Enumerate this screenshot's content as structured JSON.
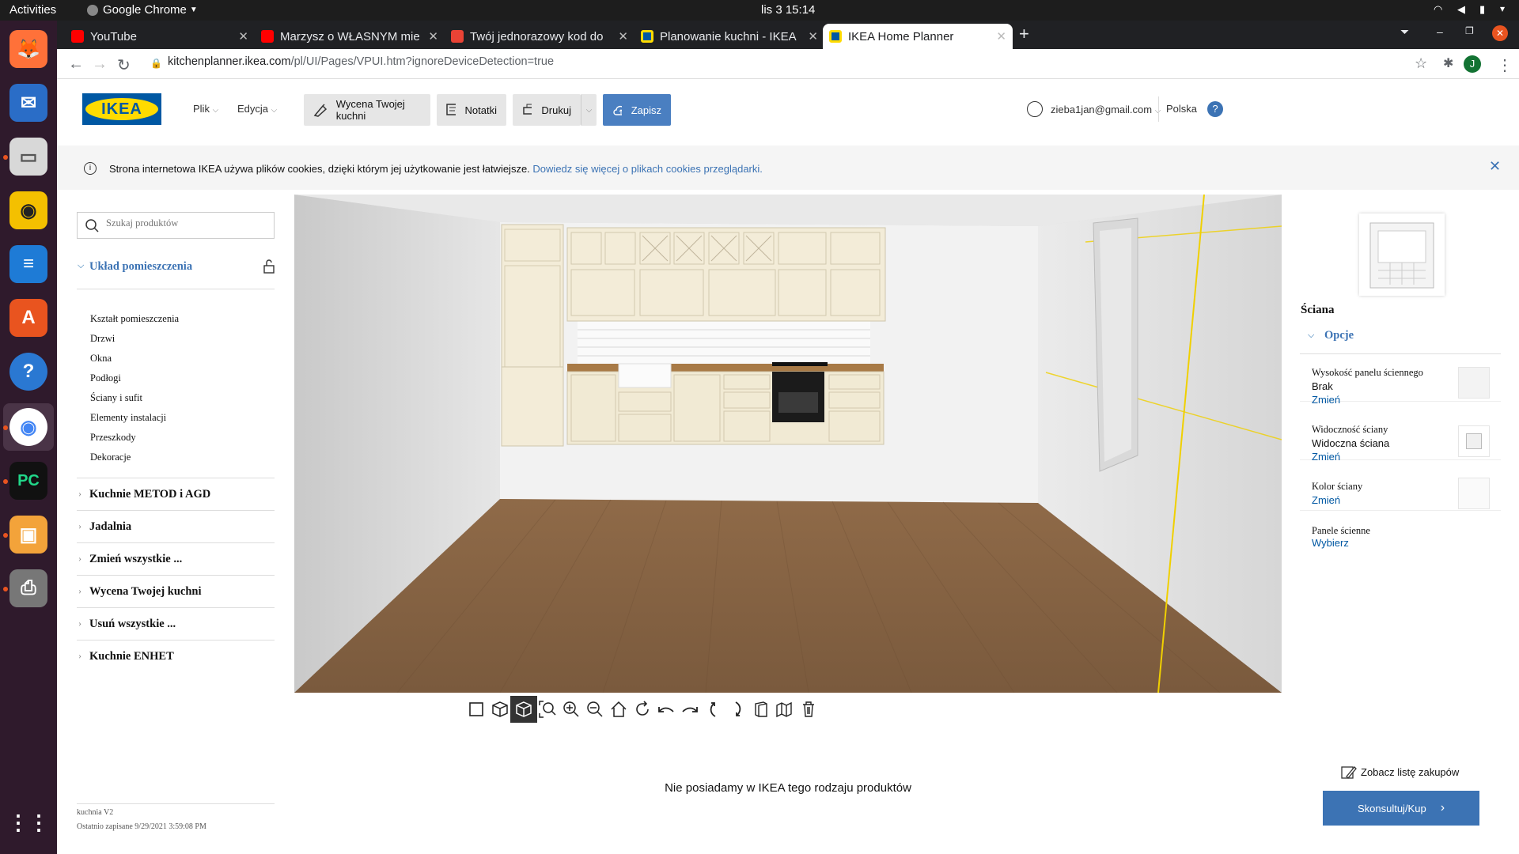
{
  "os": {
    "activities": "Activities",
    "app_menu": "Google Chrome",
    "clock": "lis 3  15:14"
  },
  "tabs": [
    {
      "title": "YouTube",
      "icon": "youtube-icon",
      "color": "#ff0000"
    },
    {
      "title": "Marzysz o WŁASNYM mie",
      "icon": "youtube-icon",
      "color": "#ff0000"
    },
    {
      "title": "Twój jednorazowy kod do",
      "icon": "gmail-icon",
      "color": "#ea4335"
    },
    {
      "title": "Planowanie kuchni - IKEA",
      "icon": "ikea-icon",
      "color": "#0058a3"
    },
    {
      "title": "IKEA Home Planner",
      "icon": "ikea-icon",
      "color": "#0058a3"
    }
  ],
  "address": {
    "domain": "kitchenplanner.ikea.com",
    "path": "/pl/UI/Pages/VPUI.htm?ignoreDeviceDetection=true"
  },
  "profile_initial": "J",
  "header": {
    "logo": "IKEA",
    "menu_file": "Plik",
    "menu_edit": "Edycja",
    "price_btn": "Wycena Twojej kuchni",
    "notes_btn": "Notatki",
    "print_btn": "Drukuj",
    "save_btn": "Zapisz",
    "account": "zieba1jan@gmail.com",
    "country": "Polska",
    "help": "?"
  },
  "cookie": {
    "text": "Strona internetowa IKEA używa plików cookies, dzięki którym jej użytkowanie jest łatwiejsze.",
    "link": "Dowiedz się więcej o plikach cookies przeglądarki."
  },
  "sidebar": {
    "search_placeholder": "Szukaj produktów",
    "room_layout": "Układ pomieszczenia",
    "room_items": [
      "Kształt pomieszczenia",
      "Drzwi",
      "Okna",
      "Podłogi",
      "Ściany i sufit",
      "Elementy instalacji",
      "Przeszkody",
      "Dekoracje"
    ],
    "sections": [
      "Kuchnie METOD i AGD",
      "Jadalnia",
      "Zmień wszystkie ...",
      "Wycena Twojej kuchni",
      "Usuń wszystkie ...",
      "Kuchnie ENHET"
    ],
    "project_name": "kuchnia V2",
    "last_saved": "Ostatnio zapisane 9/29/2021 3:59:08 PM"
  },
  "tools": [
    "2d-view-icon",
    "3d-view-icon",
    "3d-solid-view-icon",
    "zoom-fit-icon",
    "zoom-in-icon",
    "zoom-out-icon",
    "home-icon",
    "rotate-icon",
    "undo-icon",
    "redo-icon",
    "tilt-up-icon",
    "tilt-down-icon",
    "wall-icon",
    "walls-icon",
    "trash-icon"
  ],
  "status_message": "Nie posiadamy w IKEA tego rodzaju produktów",
  "right": {
    "title": "Ściana",
    "options_label": "Opcje",
    "options": [
      {
        "label": "Wysokość panelu ściennego",
        "value": "Brak",
        "link": "Zmień"
      },
      {
        "label": "Widoczność ściany",
        "value": "Widoczna ściana",
        "link": "Zmień"
      },
      {
        "label": "Kolor ściany",
        "value": "",
        "link": "Zmień"
      },
      {
        "label": "Panele ścienne",
        "value": "",
        "link": "Wybierz"
      }
    ],
    "shopping_list": "Zobacz listę zakupów",
    "consult_btn": "Skonsultuj/Kup"
  },
  "colors": {
    "ikea_blue": "#0058a3",
    "ikea_yellow": "#ffdb00",
    "link": "#0058a3",
    "consult_btn": "#3c73b4"
  }
}
